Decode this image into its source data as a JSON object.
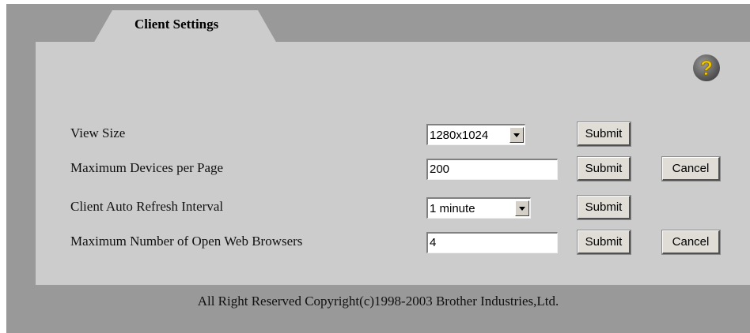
{
  "tab": {
    "label": "Client Settings"
  },
  "help": {
    "icon": "help-question-icon",
    "glyph": "?"
  },
  "settings": [
    {
      "label": "View Size",
      "control": "select",
      "value": "1280x1024",
      "submit": "Submit"
    },
    {
      "label": "Maximum Devices per Page",
      "control": "text",
      "value": "200",
      "submit": "Submit",
      "cancel": "Cancel"
    },
    {
      "label": "Client Auto Refresh Interval",
      "control": "select",
      "value": "1 minute",
      "submit": "Submit"
    },
    {
      "label": "Maximum Number of Open Web Browsers",
      "control": "text",
      "value": "4",
      "submit": "Submit",
      "cancel": "Cancel"
    }
  ],
  "footer": {
    "text": "All Right Reserved Copyright(c)1998-2003 Brother Industries,Ltd."
  },
  "colors": {
    "frame": "#999999",
    "panel": "#cccccc",
    "help_icon": "#e8c200"
  }
}
